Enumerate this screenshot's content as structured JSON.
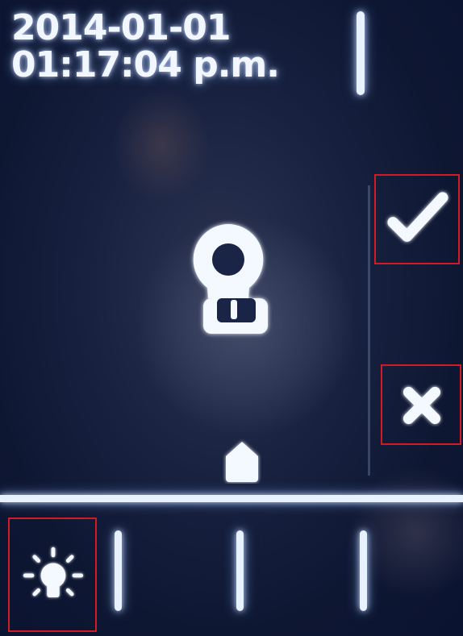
{
  "status": {
    "date": "2014-01-01",
    "time": "01:17:04 p.m."
  },
  "controls": {
    "confirm_icon": "checkmark-icon",
    "cancel_icon": "close-icon",
    "unlock_icon": "keyhole-icon",
    "unlock_arrow_icon": "up-arrow-icon",
    "light_icon": "lightbulb-icon"
  },
  "colors": {
    "background": "#0b1430",
    "glow": "#e8f1ff",
    "highlight_box": "#d01c22"
  }
}
